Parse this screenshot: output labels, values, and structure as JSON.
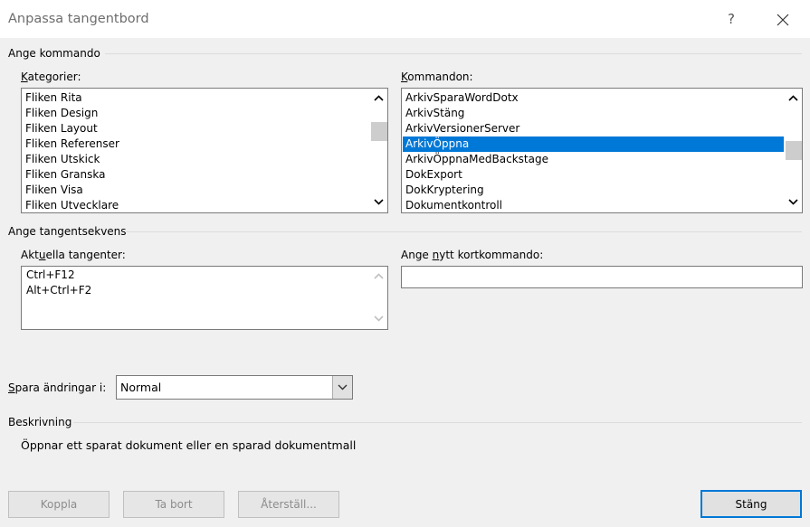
{
  "dialog": {
    "title": "Anpassa tangentbord",
    "help_label": "?"
  },
  "command_group": {
    "label": "Ange kommando",
    "categories": {
      "label_accel": "K",
      "label_rest": "ategorier:",
      "items": [
        "Fliken Rita",
        "Fliken Design",
        "Fliken Layout",
        "Fliken Referenser",
        "Fliken Utskick",
        "Fliken Granska",
        "Fliken Visa",
        "Fliken Utvecklare"
      ]
    },
    "commands": {
      "label_accel": "K",
      "label_rest": "ommandon:",
      "items": [
        "ArkivSparaWordDotx",
        "ArkivStäng",
        "ArkivVersionerServer",
        "ArkivÖppna",
        "ArkivÖppnaMedBackstage",
        "DokExport",
        "DokKryptering",
        "Dokumentkontroll"
      ],
      "selected": "ArkivÖppna"
    }
  },
  "keys_group": {
    "label": "Ange tangentsekvens",
    "current_keys": {
      "label_pre": "Akt",
      "label_accel": "u",
      "label_rest": "ella tangenter:",
      "items": [
        "Ctrl+F12",
        "Alt+Ctrl+F2"
      ]
    },
    "new_shortcut": {
      "label_pre": "Ange ",
      "label_accel": "n",
      "label_rest": "ytt kortkommando:",
      "value": ""
    }
  },
  "save_in": {
    "label_accel": "S",
    "label_rest": "para ändringar i:",
    "value": "Normal"
  },
  "description": {
    "label": "Beskrivning",
    "text": "Öppnar ett sparat dokument eller en sparad dokumentmall"
  },
  "buttons": {
    "assign": "Koppla",
    "remove": "Ta bort",
    "reset": "Återställ...",
    "close": "Stäng"
  }
}
